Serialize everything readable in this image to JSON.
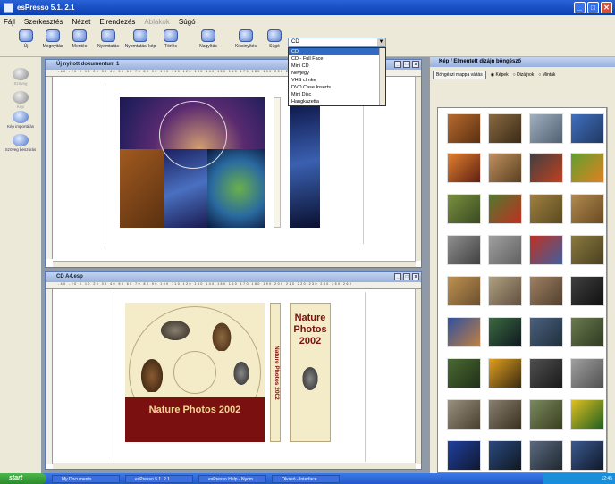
{
  "app": {
    "title": "esPresso 5.1. 2.1"
  },
  "menu": [
    "Fájl",
    "Szerkesztés",
    "Nézet",
    "Elrendezés",
    "Ablakok",
    "Súgó"
  ],
  "toolbar": [
    {
      "label": "Új",
      "icon": "new-icon"
    },
    {
      "label": "Megnyitás",
      "icon": "open-icon"
    },
    {
      "label": "Mentés",
      "icon": "save-icon"
    },
    {
      "label": "Nyomtatás",
      "icon": "print-icon"
    },
    {
      "label": "Nyomtatási kép",
      "icon": "preview-icon"
    },
    {
      "label": "Törlés",
      "icon": "delete-icon"
    },
    {
      "label": "Nagyítás",
      "icon": "zoom-in-icon"
    },
    {
      "label": "Kicsinyítés",
      "icon": "zoom-out-icon"
    },
    {
      "label": "Súgó",
      "icon": "help-icon"
    }
  ],
  "format_combo": {
    "value": "CD"
  },
  "format_options": [
    "CD",
    "CD - Full Face",
    "Mini CD",
    "Névjegy",
    "VHS címke",
    "DVD Case Inserts",
    "Mini Disc",
    "Hangkazetta"
  ],
  "left_panel": [
    "Szöveg",
    "Kép",
    "Kép importálás",
    "Szöveg beszúrás"
  ],
  "doc1": {
    "title": "Új nyitott dokumentum 1"
  },
  "doc2": {
    "title": "CD A4.esp",
    "label_text": "Nature Photos 2002",
    "spine_text": "Nature Photos 2002",
    "insert_lines": [
      "Nature",
      "Photos",
      "2002"
    ]
  },
  "browser": {
    "title": "Kép / Elmentett dizájn böngésző",
    "folder_button": "Böngészi mappa váltás",
    "radio_options": [
      "Képek",
      "Dizájnok",
      "Minták"
    ],
    "selected_radio": "Képek"
  },
  "taskbar": {
    "start": "start",
    "tasks": [
      "My Documents",
      "esPresso 5.1. 2.1",
      "esPresso Help - Nyom...",
      "Olvasó - Interface"
    ],
    "clock": "12:45"
  },
  "colors": {
    "accent": "#2a62d8",
    "label_red": "#7a1010",
    "label_cream": "#f4ecc8",
    "text_brown": "#7a1010"
  }
}
